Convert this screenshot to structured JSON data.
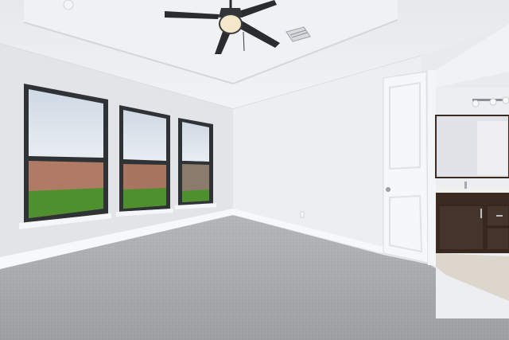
{
  "scene": {
    "kind": "photo",
    "subject": "empty bedroom"
  },
  "colors": {
    "ceiling": "#eceef1",
    "wall_left": "#e4e6e9",
    "wall_back": "#ebedf0",
    "carpet": "#a9abae",
    "window_frame": "#2f3336",
    "sky": "#dbe3ec",
    "grass": "#4e8f2e",
    "fence": "#a87561",
    "door": "#f6f7f8",
    "vanity": "#3a2a20",
    "bath_floor": "#dcd6cd"
  },
  "icons": [
    "ceiling-fan-icon",
    "air-vent-icon",
    "light-fixture-icon"
  ]
}
